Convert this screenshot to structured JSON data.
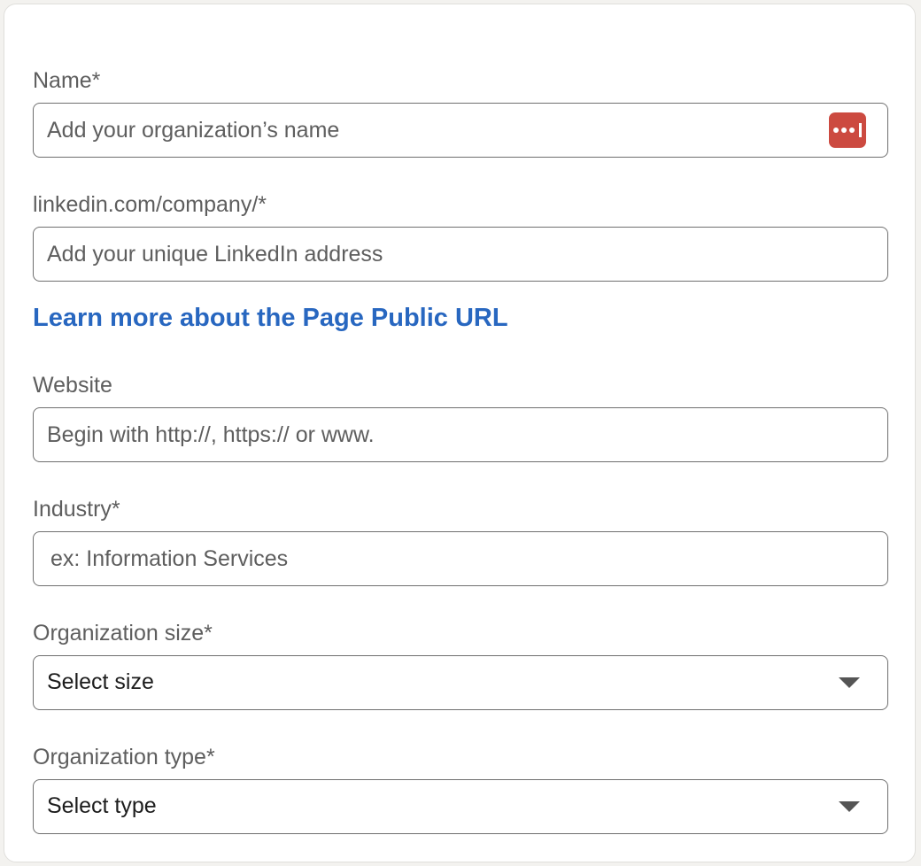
{
  "form": {
    "name": {
      "label": "Name*",
      "placeholder": "Add your organization’s name",
      "password_manager_icon": "password-manager-icon"
    },
    "linkedin_url": {
      "label": "linkedin.com/company/*",
      "placeholder": "Add your unique LinkedIn address"
    },
    "learn_more_link": "Learn more about the Page Public URL",
    "website": {
      "label": "Website",
      "placeholder": "Begin with http://, https:// or www."
    },
    "industry": {
      "label": "Industry*",
      "placeholder": "ex: Information Services"
    },
    "org_size": {
      "label": "Organization size*",
      "selected": "Select size"
    },
    "org_type": {
      "label": "Organization type*",
      "selected": "Select type"
    }
  },
  "colors": {
    "link": "#2867c0",
    "password_manager": "#cc4a40",
    "border": "#6f6f6f"
  }
}
